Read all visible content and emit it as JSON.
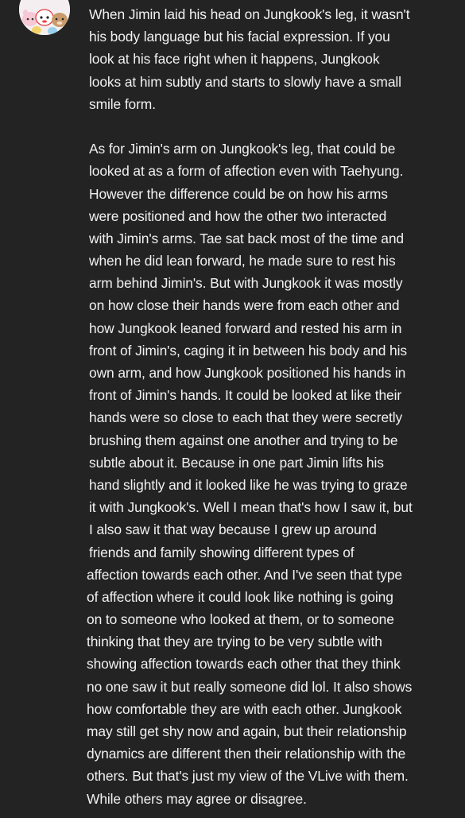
{
  "comment": {
    "paragraph1": [
      "When Jimin laid his head on Jungkook's leg, it wasn't",
      "his body language but his facial expression. If you",
      "look at his face right when it happens, Jungkook",
      "looks at him subtly and starts to slowly have a small",
      "smile form."
    ],
    "paragraph2": [
      "As for Jimin's arm on Jungkook's leg, that could be",
      "looked at as a form of affection even with Taehyung.",
      "However the difference could be on how his arms",
      "were positioned and how the other two interacted",
      "with Jimin's arms. Tae sat back most of the time and",
      "when he did lean forward, he made sure to rest his",
      "arm behind Jimin's. But with Jungkook it was mostly",
      "on how close their hands were from each other and",
      "how Jungkook leaned forward and rested his arm in",
      "front of Jimin's, caging it in between his body and his",
      "own arm, and how Jungkook positioned his hands in",
      "front of Jimin's hands. It could be looked at like their",
      "hands were so close to each that they were secretly",
      "brushing them against one another and trying to be",
      "subtle about it. Because in one part Jimin lifts his",
      "hand slightly and it looked like he was trying to graze",
      "it with Jungkook's. Well I mean that's how I saw it, but",
      "I also saw it that way because I grew up around",
      "friends and family showing different types of"
    ],
    "paragraph3": [
      "affection towards each other. And I've seen that type",
      "of affection where it could look like nothing is going",
      "on to someone who looked at them, or to someone",
      "thinking that they are trying to be very subtle with",
      "showing affection towards each other that they think",
      "no one saw it but really someone did lol. It also shows",
      "how comfortable they are with each other. Jungkook",
      "may still get shy now and again, but their relationship",
      "dynamics are different then their relationship with the",
      "others. But that's just my view of the VLive with them.",
      "While others may agree or disagree."
    ]
  },
  "avatar_icon": "cartoon-characters-avatar",
  "colors": {
    "background": "#232323",
    "text": "#f1f1f1"
  }
}
